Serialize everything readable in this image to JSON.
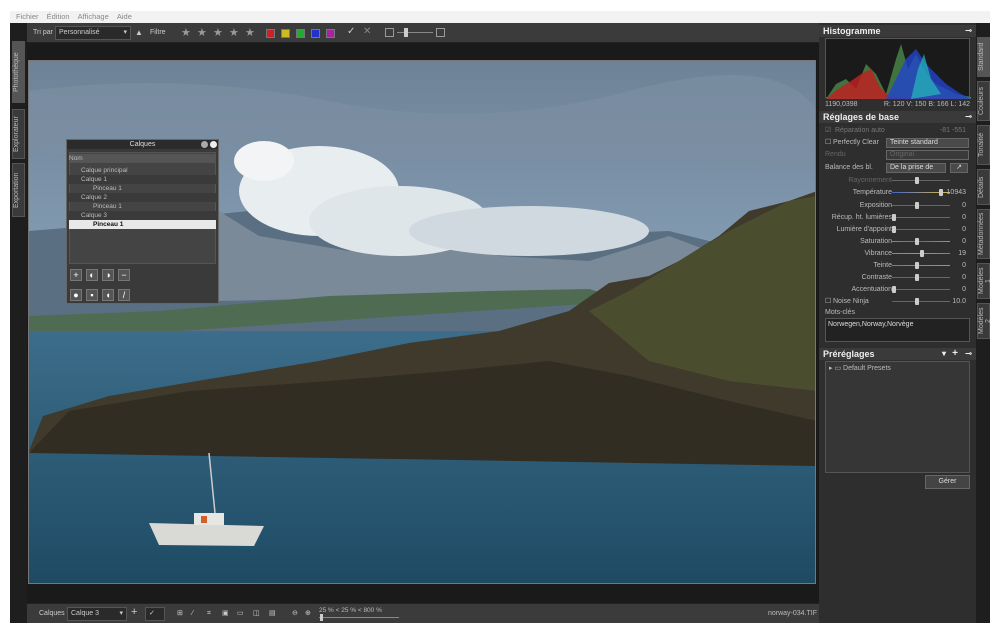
{
  "menu": [
    "Fichier",
    "Édition",
    "Affichage",
    "Aide"
  ],
  "left_tabs": [
    "Photothèque",
    "Explorateur",
    "Exportation"
  ],
  "toolbar": {
    "sort_label": "Tri par :",
    "sort_value": "Personnalisé",
    "filter_label": "Filtre",
    "stars": [
      "★",
      "★",
      "★",
      "★",
      "★"
    ],
    "color_labels": [
      "#cc2222",
      "#ccbb22",
      "#22aa33",
      "#2233cc",
      "#aa22aa"
    ]
  },
  "layers_panel": {
    "title": "Calques",
    "header": "Nom",
    "layers": [
      "Calque principal",
      "Calque 1",
      "Pinceau 1",
      "Calque 2",
      "Pinceau 1",
      "Calque 3",
      "Pinceau 1"
    ]
  },
  "bottombar": {
    "layers_label": "Calques",
    "layer_select": "Calque 3",
    "zoom_text": "25 % < 25 % < 800 %",
    "filename": "norway-034.TIF"
  },
  "histogram": {
    "title": "Histogramme",
    "coords": "1190,0398",
    "rgb": "R: 120 V: 150 B: 166 L: 142"
  },
  "basic": {
    "title": "Réglages de base",
    "auto_repair": "Réparation auto",
    "auto_values": "-81  -551",
    "perfectly_clear": "Perfectly Clear",
    "perfectly_value": "Teinte standard",
    "rendu_label": "Rendu",
    "rendu_value": "Original",
    "wb_label": "Balance des bl.",
    "wb_value": "De la prise de",
    "sliders": [
      {
        "label": "Rayonnement",
        "value": ""
      },
      {
        "label": "Température",
        "value": "10943"
      },
      {
        "label": "Exposition",
        "value": "0"
      },
      {
        "label": "Récup. ht. lumières",
        "value": "0"
      },
      {
        "label": "Lumière d'appoint",
        "value": "0"
      },
      {
        "label": "Saturation",
        "value": "0"
      },
      {
        "label": "Vibrance",
        "value": "19"
      },
      {
        "label": "Teinte",
        "value": "0"
      },
      {
        "label": "Contraste",
        "value": "0"
      },
      {
        "label": "Accentuation",
        "value": "0"
      }
    ],
    "noise": {
      "label": "Noise Ninja",
      "value": "10.0"
    },
    "keywords_label": "Mots-clés",
    "keywords": "Norwegen,Norway,Norvège"
  },
  "presets": {
    "title": "Préréglages",
    "item": "Default Presets",
    "manage": "Gérer"
  },
  "right_tabs": [
    "Standard",
    "Couleurs",
    "Tonalité",
    "Détails",
    "Métadonnées",
    "Modèles 1",
    "Modèles 2"
  ]
}
